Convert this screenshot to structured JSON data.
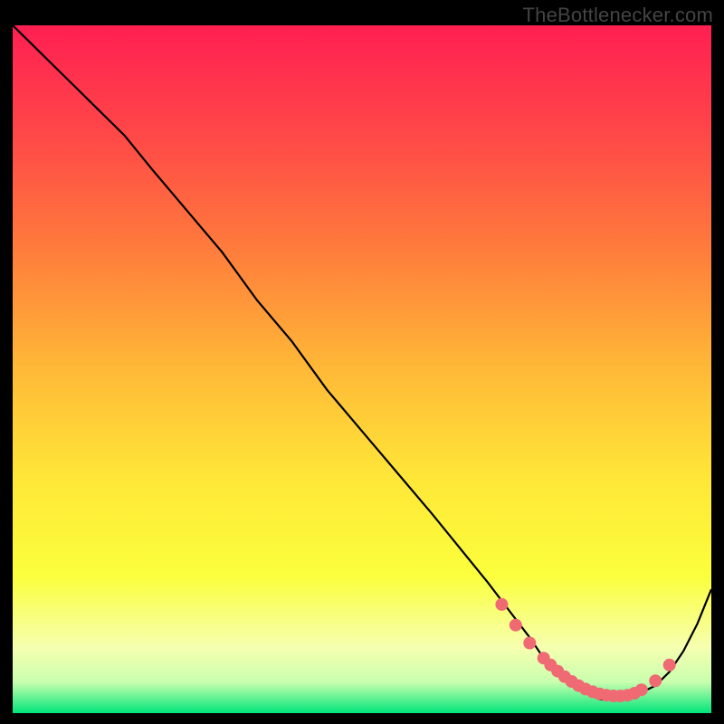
{
  "watermark": "TheBottlenecker.com",
  "chart_data": {
    "type": "line",
    "title": "",
    "xlabel": "",
    "ylabel": "",
    "xlim": [
      0,
      100
    ],
    "ylim": [
      0,
      100
    ],
    "curve": {
      "x": [
        0,
        3,
        6,
        9,
        12,
        16,
        20,
        25,
        30,
        35,
        40,
        45,
        50,
        55,
        60,
        64,
        68,
        71,
        74,
        76,
        78,
        80,
        82,
        84,
        86,
        88,
        90,
        92,
        94,
        96,
        98,
        100
      ],
      "y": [
        100,
        97,
        94,
        91,
        88,
        84,
        79,
        73,
        67,
        60,
        54,
        47,
        41,
        35,
        29,
        24,
        19,
        15,
        11,
        8,
        6,
        4,
        3,
        2,
        2,
        2,
        3,
        4,
        6,
        9,
        13,
        18
      ]
    },
    "green_band": {
      "y0": 0,
      "y1": 3.5
    },
    "yellow_band": {
      "y0": 3.5,
      "y1": 7
    },
    "markers": {
      "x": [
        70,
        72,
        74,
        76,
        77,
        78,
        79,
        80,
        81,
        82,
        83,
        84,
        85,
        86,
        87,
        88,
        89,
        90,
        92,
        94
      ],
      "y": [
        15.8,
        12.8,
        10.2,
        8.0,
        7.0,
        6.1,
        5.3,
        4.6,
        4.0,
        3.5,
        3.1,
        2.8,
        2.6,
        2.5,
        2.5,
        2.6,
        2.9,
        3.4,
        4.7,
        7.0
      ],
      "color": "#ef6a72",
      "size": 7
    },
    "background_gradient": {
      "stops": [
        {
          "offset": 0.0,
          "color": "#ff1f52"
        },
        {
          "offset": 0.16,
          "color": "#ff4848"
        },
        {
          "offset": 0.32,
          "color": "#ff7a3c"
        },
        {
          "offset": 0.5,
          "color": "#ffb937"
        },
        {
          "offset": 0.66,
          "color": "#ffe738"
        },
        {
          "offset": 0.8,
          "color": "#fbff3c"
        },
        {
          "offset": 0.905,
          "color": "#f6ffb0"
        },
        {
          "offset": 0.955,
          "color": "#c8ffae"
        },
        {
          "offset": 1.0,
          "color": "#00e57a"
        }
      ]
    }
  }
}
